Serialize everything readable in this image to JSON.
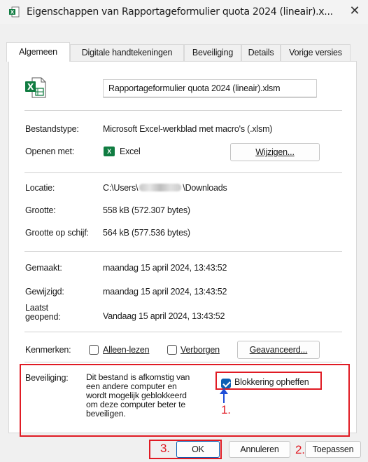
{
  "window": {
    "title": "Eigenschappen van Rapportageformulier quota 2024 (lineair).x...",
    "close_glyph": "✕",
    "app_icon": "excel-file-icon"
  },
  "tabs": [
    {
      "label": "Algemeen",
      "active": true
    },
    {
      "label": "Digitale handtekeningen",
      "active": false
    },
    {
      "label": "Beveiliging",
      "active": false
    },
    {
      "label": "Details",
      "active": false
    },
    {
      "label": "Vorige versies",
      "active": false
    }
  ],
  "general": {
    "file_icon": "excel-file-icon",
    "filename": "Rapportageformulier quota 2024 (lineair).xlsm",
    "type_label": "Bestandstype:",
    "type_value": "Microsoft Excel-werkblad met macro's (.xlsm)",
    "open_with_label": "Openen met:",
    "open_with_app": "Excel",
    "open_with_app_icon": "X",
    "change_button": "Wijzigen...",
    "location_label": "Locatie:",
    "location_prefix": "C:\\Users\\",
    "location_suffix": "\\Downloads",
    "size_label": "Grootte:",
    "size_value": "558 kB (572.307 bytes)",
    "size_disk_label": "Grootte op schijf:",
    "size_disk_value": "564 kB (577.536 bytes)",
    "created_label": "Gemaakt:",
    "created_value": "maandag 15 april 2024, 13:43:52",
    "modified_label": "Gewijzigd:",
    "modified_value": "maandag 15 april 2024, 13:43:52",
    "accessed_label_1": "Laatst",
    "accessed_label_2": "geopend:",
    "accessed_value": "Vandaag 15 april 2024, 13:43:52",
    "attributes_label": "Kenmerken:",
    "readonly_label": "Alleen-lezen",
    "hidden_label": "Verborgen",
    "advanced_button": "Geavanceerd...",
    "security_label": "Beveiliging:",
    "security_text_1": "Dit bestand is afkomstig van",
    "security_text_2": "een andere computer en",
    "security_text_3": "wordt mogelijk geblokkeerd",
    "security_text_4": "om deze computer beter te",
    "security_text_5": "beveiligen.",
    "unblock_label": "Blokkering opheffen",
    "unblock_checked": true
  },
  "annotations": {
    "step1": "1.",
    "step2": "2.",
    "step3": "3.",
    "color": "#e01b24",
    "arrow_color": "#1f4fd8"
  },
  "footer": {
    "ok": "OK",
    "cancel": "Annuleren",
    "apply": "Toepassen"
  }
}
